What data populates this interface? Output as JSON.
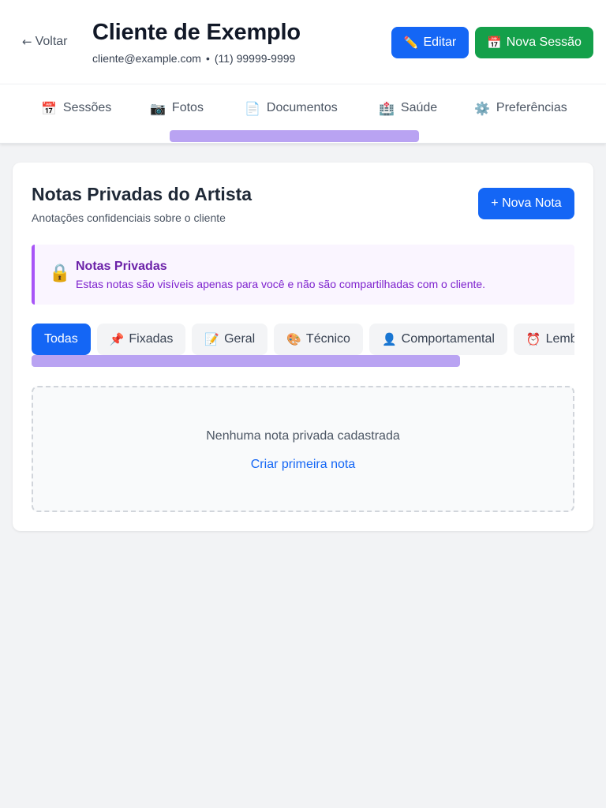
{
  "header": {
    "back_label": "Voltar",
    "back_icon": "←",
    "client_name": "Cliente de Exemplo",
    "email": "cliente@example.com",
    "separator": "•",
    "phone": "(11) 99999-9999",
    "edit_icon": "✏️",
    "edit_label": "Editar",
    "new_session_icon": "📅",
    "new_session_label": "Nova Sessão"
  },
  "tabs": [
    {
      "icon": "📅",
      "label": "Sessões"
    },
    {
      "icon": "📷",
      "label": "Fotos"
    },
    {
      "icon": "📄",
      "label": "Documentos"
    },
    {
      "icon": "🏥",
      "label": "Saúde"
    },
    {
      "icon": "⚙️",
      "label": "Preferências"
    }
  ],
  "notes": {
    "title": "Notas Privadas do Artista",
    "subtitle": "Anotações confidenciais sobre o cliente",
    "new_note_label": "+ Nova Nota",
    "alert": {
      "icon": "🔒",
      "title": "Notas Privadas",
      "text": "Estas notas são visíveis apenas para você e não são compartilhadas com o cliente."
    },
    "filters": [
      {
        "icon": "",
        "label": "Todas",
        "active": true
      },
      {
        "icon": "📌",
        "label": "Fixadas"
      },
      {
        "icon": "📝",
        "label": "Geral"
      },
      {
        "icon": "🎨",
        "label": "Técnico"
      },
      {
        "icon": "👤",
        "label": "Comportamental"
      },
      {
        "icon": "⏰",
        "label": "Lembretes"
      }
    ],
    "empty": {
      "message": "Nenhuma nota privada cadastrada",
      "action_label": "Criar primeira nota"
    }
  },
  "colors": {
    "primary": "#1466f5",
    "success": "#14a04a",
    "alert_accent": "#a855f7",
    "alert_title": "#6b21a8",
    "scrollbar": "#b9a3f2"
  }
}
